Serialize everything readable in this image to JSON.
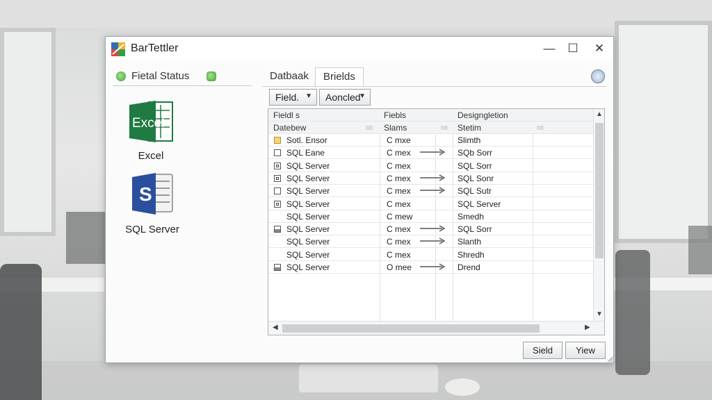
{
  "window": {
    "title": "BarTettler",
    "controls": {
      "minimize": "—",
      "maximize": "☐",
      "close": "✕"
    }
  },
  "left_pane": {
    "status_label": "Fietal Status",
    "data_sources": [
      {
        "label": "Excel",
        "icon": "excel-icon",
        "icon_text": "Excel"
      },
      {
        "label": "SQL Server",
        "icon": "sql-server-icon",
        "icon_text": "S"
      }
    ]
  },
  "tabs": [
    {
      "label": "Datbaak",
      "active": false
    },
    {
      "label": "Brields",
      "active": true
    }
  ],
  "toolbar": {
    "field_dropdown": "Field.",
    "annotated_dropdown": "Aoncled"
  },
  "grid": {
    "header1": [
      "Fieldl s",
      "Fiebls",
      "Designgletion"
    ],
    "header2": [
      "Datebew",
      "Slams",
      "Stetim"
    ],
    "rows": [
      {
        "icon": "yellow",
        "col1": "Sotl. Ensor",
        "col2": "C mxe",
        "arrow": false,
        "col3": "Slimth"
      },
      {
        "icon": "plain",
        "col1": "SQL Eane",
        "col2": "C mex",
        "arrow": true,
        "col3": "SQb Sorr"
      },
      {
        "icon": "box",
        "col1": "SQL Server",
        "col2": "C mex",
        "arrow": false,
        "col3": "SQL Sorr"
      },
      {
        "icon": "box",
        "col1": "SQL Server",
        "col2": "C mex",
        "arrow": true,
        "col3": "SQL Sonr"
      },
      {
        "icon": "plain",
        "col1": "SQL Server",
        "col2": "C mex",
        "arrow": true,
        "col3": "SQL Sutr"
      },
      {
        "icon": "box",
        "col1": "SQL Server",
        "col2": "C mex",
        "arrow": false,
        "col3": "SQL Server"
      },
      {
        "icon": "none",
        "col1": "SQL Server",
        "col2": "C mew",
        "arrow": false,
        "col3": "Smedh"
      },
      {
        "icon": "half",
        "col1": "SQL Server",
        "col2": "C mex",
        "arrow": true,
        "col3": "SQL Sorr"
      },
      {
        "icon": "none",
        "col1": "SQL Server",
        "col2": "C mex",
        "arrow": true,
        "col3": "Slanth"
      },
      {
        "icon": "none",
        "col1": "SQL Server",
        "col2": "C mex",
        "arrow": false,
        "col3": "Shredh"
      },
      {
        "icon": "half",
        "col1": "SQL Server",
        "col2": "O mee",
        "arrow": true,
        "col3": "Drend"
      }
    ]
  },
  "buttons": {
    "stield": "Sield",
    "view": "Yiew"
  }
}
